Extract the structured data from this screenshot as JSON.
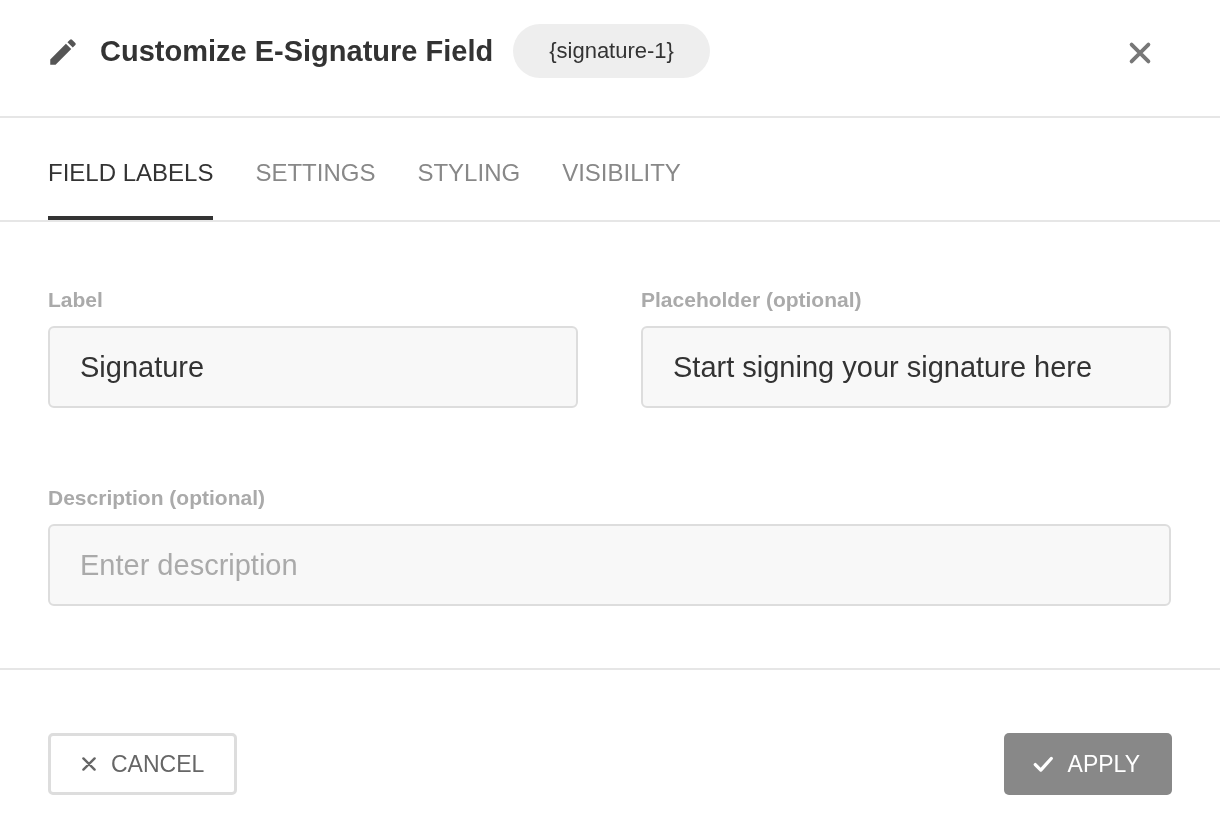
{
  "dialog": {
    "title": "Customize E-Signature Field",
    "tag": "{signature-1}"
  },
  "tabs": [
    {
      "label": "FIELD LABELS",
      "selected": true
    },
    {
      "label": "SETTINGS",
      "selected": false
    },
    {
      "label": "STYLING",
      "selected": false
    },
    {
      "label": "VISIBILITY",
      "selected": false
    }
  ],
  "fields": [
    {
      "label": "Label",
      "value": "Signature"
    },
    {
      "label": "Placeholder (optional)",
      "value": "Start signing your signature here"
    },
    {
      "label": "Description (optional)",
      "placeholder": "Enter description"
    }
  ],
  "buttons": {
    "cancel": "CANCEL",
    "apply": "APPLY"
  }
}
